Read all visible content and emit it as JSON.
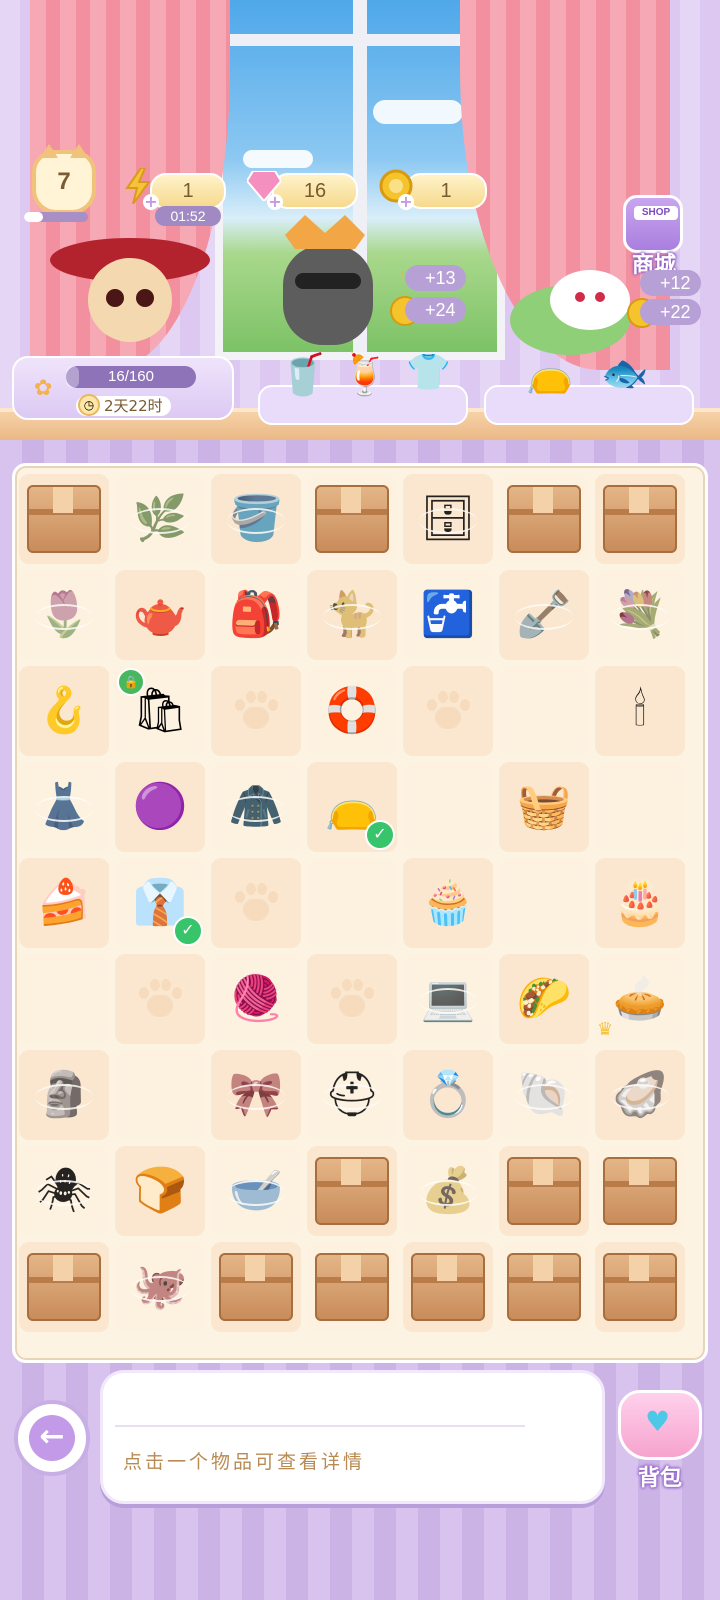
{
  "hud": {
    "level": "7",
    "energy": {
      "value": "1",
      "timer": "01:52",
      "icon": "lightning-icon"
    },
    "gems": {
      "value": "16",
      "icon": "gem-icon"
    },
    "coins": {
      "value": "1",
      "icon": "coin-icon"
    },
    "shop_label": "商城",
    "shop_sign": "SHOP"
  },
  "orders": {
    "progress_text": "16/160",
    "progress_fraction": 0.1,
    "time_left": "2天22时",
    "customer_center": {
      "reward_hearts": "+13",
      "reward_coins": "+24"
    },
    "customer_right": {
      "reward_hearts": "+12",
      "reward_coins": "+22"
    }
  },
  "board": {
    "rows": [
      [
        "box",
        "plant-web",
        "watering-can-web",
        "box",
        "cabinet-web",
        "box",
        "box"
      ],
      [
        "tulip-web",
        "pitcher",
        "cat-backpack",
        "cat-plush-web",
        "water-dispenser",
        "shovel-web",
        "bouquet-web"
      ],
      [
        "hanger",
        "tote-bag-locked",
        "paw",
        "swim-ring",
        "paw",
        "empty",
        "candelabra"
      ],
      [
        "dress-web",
        "purple-pillow",
        "clothes-rack-web",
        "bag-check",
        "empty",
        "fruit-basket",
        "empty"
      ],
      [
        "cake-slice",
        "shirt-check",
        "paw",
        "empty",
        "cream-puff",
        "empty",
        "strawberry-cake"
      ],
      [
        "empty",
        "paw",
        "green-sweater",
        "paw",
        "computer-web",
        "cat-taco",
        "fruit-tart-crown"
      ],
      [
        "statue-web",
        "empty",
        "ribbon-web",
        "helmet-web",
        "jewelry-box",
        "shell-web",
        "seashell-web"
      ],
      [
        "spider-web",
        "bread",
        "cat-bowl-web",
        "box",
        "sack-web",
        "box",
        "box"
      ],
      [
        "box",
        "octopus-web",
        "box",
        "box",
        "box",
        "box",
        "box"
      ]
    ]
  },
  "bottom": {
    "hint": "点击一个物品可查看详情",
    "bag_label": "背包"
  },
  "colors": {
    "accent": "#c29ae8",
    "board_bg": "#fdf3e3",
    "check": "#37c46a"
  }
}
